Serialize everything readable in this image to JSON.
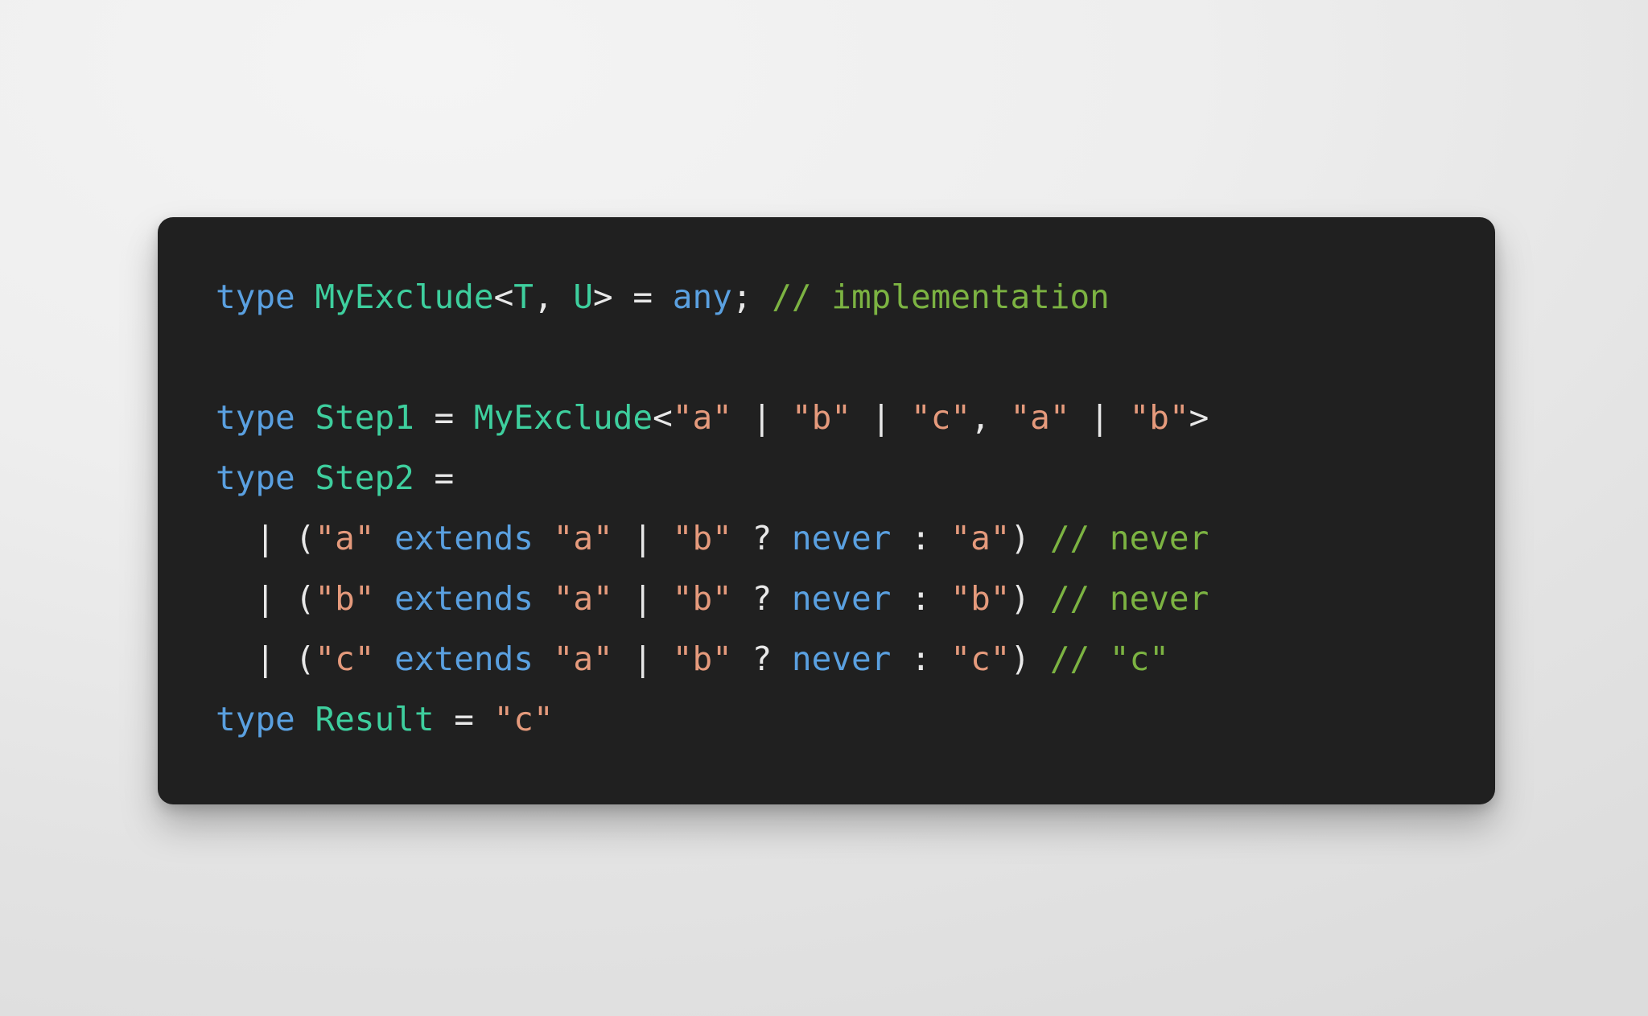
{
  "page": {
    "background_color": "#eeeeee",
    "card_background_color": "#202020"
  },
  "theme": {
    "keyword_color": "#5aa0e0",
    "type_color": "#3ecf9e",
    "string_color": "#e59a7c",
    "comment_color": "#7cb342",
    "punctuation_color": "#e8e8e8",
    "language": "typescript"
  },
  "code": {
    "full_text": "type MyExclude<T, U> = any; // implementation\n\ntype Step1 = MyExclude<\"a\" | \"b\" | \"c\", \"a\" | \"b\">\ntype Step2 =\n  | (\"a\" extends \"a\" | \"b\" ? never : \"a\") // never\n  | (\"b\" extends \"a\" | \"b\" ? never : \"b\") // never\n  | (\"c\" extends \"a\" | \"b\" ? never : \"c\") // \"c\"\ntype Result = \"c\"",
    "lines": [
      {
        "tokens": [
          {
            "text": "type",
            "kind": "keyword"
          },
          {
            "text": " ",
            "kind": "plain"
          },
          {
            "text": "MyExclude",
            "kind": "type"
          },
          {
            "text": "<",
            "kind": "punctuation"
          },
          {
            "text": "T",
            "kind": "type"
          },
          {
            "text": ", ",
            "kind": "punctuation"
          },
          {
            "text": "U",
            "kind": "type"
          },
          {
            "text": "> ",
            "kind": "punctuation"
          },
          {
            "text": "= ",
            "kind": "punctuation"
          },
          {
            "text": "any",
            "kind": "keyword"
          },
          {
            "text": "; ",
            "kind": "punctuation"
          },
          {
            "text": "// implementation",
            "kind": "comment"
          }
        ]
      },
      {
        "tokens": []
      },
      {
        "tokens": [
          {
            "text": "type",
            "kind": "keyword"
          },
          {
            "text": " ",
            "kind": "plain"
          },
          {
            "text": "Step1",
            "kind": "type"
          },
          {
            "text": " = ",
            "kind": "punctuation"
          },
          {
            "text": "MyExclude",
            "kind": "type"
          },
          {
            "text": "<",
            "kind": "punctuation"
          },
          {
            "text": "\"a\"",
            "kind": "string"
          },
          {
            "text": " | ",
            "kind": "punctuation"
          },
          {
            "text": "\"b\"",
            "kind": "string"
          },
          {
            "text": " | ",
            "kind": "punctuation"
          },
          {
            "text": "\"c\"",
            "kind": "string"
          },
          {
            "text": ", ",
            "kind": "punctuation"
          },
          {
            "text": "\"a\"",
            "kind": "string"
          },
          {
            "text": " | ",
            "kind": "punctuation"
          },
          {
            "text": "\"b\"",
            "kind": "string"
          },
          {
            "text": ">",
            "kind": "punctuation"
          }
        ]
      },
      {
        "tokens": [
          {
            "text": "type",
            "kind": "keyword"
          },
          {
            "text": " ",
            "kind": "plain"
          },
          {
            "text": "Step2",
            "kind": "type"
          },
          {
            "text": " =",
            "kind": "punctuation"
          }
        ]
      },
      {
        "tokens": [
          {
            "text": "  | (",
            "kind": "punctuation"
          },
          {
            "text": "\"a\"",
            "kind": "string"
          },
          {
            "text": " ",
            "kind": "plain"
          },
          {
            "text": "extends",
            "kind": "keyword"
          },
          {
            "text": " ",
            "kind": "plain"
          },
          {
            "text": "\"a\"",
            "kind": "string"
          },
          {
            "text": " | ",
            "kind": "punctuation"
          },
          {
            "text": "\"b\"",
            "kind": "string"
          },
          {
            "text": " ? ",
            "kind": "punctuation"
          },
          {
            "text": "never",
            "kind": "keyword"
          },
          {
            "text": " : ",
            "kind": "punctuation"
          },
          {
            "text": "\"a\"",
            "kind": "string"
          },
          {
            "text": ") ",
            "kind": "punctuation"
          },
          {
            "text": "// never",
            "kind": "comment"
          }
        ]
      },
      {
        "tokens": [
          {
            "text": "  | (",
            "kind": "punctuation"
          },
          {
            "text": "\"b\"",
            "kind": "string"
          },
          {
            "text": " ",
            "kind": "plain"
          },
          {
            "text": "extends",
            "kind": "keyword"
          },
          {
            "text": " ",
            "kind": "plain"
          },
          {
            "text": "\"a\"",
            "kind": "string"
          },
          {
            "text": " | ",
            "kind": "punctuation"
          },
          {
            "text": "\"b\"",
            "kind": "string"
          },
          {
            "text": " ? ",
            "kind": "punctuation"
          },
          {
            "text": "never",
            "kind": "keyword"
          },
          {
            "text": " : ",
            "kind": "punctuation"
          },
          {
            "text": "\"b\"",
            "kind": "string"
          },
          {
            "text": ") ",
            "kind": "punctuation"
          },
          {
            "text": "// never",
            "kind": "comment"
          }
        ]
      },
      {
        "tokens": [
          {
            "text": "  | (",
            "kind": "punctuation"
          },
          {
            "text": "\"c\"",
            "kind": "string"
          },
          {
            "text": " ",
            "kind": "plain"
          },
          {
            "text": "extends",
            "kind": "keyword"
          },
          {
            "text": " ",
            "kind": "plain"
          },
          {
            "text": "\"a\"",
            "kind": "string"
          },
          {
            "text": " | ",
            "kind": "punctuation"
          },
          {
            "text": "\"b\"",
            "kind": "string"
          },
          {
            "text": " ? ",
            "kind": "punctuation"
          },
          {
            "text": "never",
            "kind": "keyword"
          },
          {
            "text": " : ",
            "kind": "punctuation"
          },
          {
            "text": "\"c\"",
            "kind": "string"
          },
          {
            "text": ") ",
            "kind": "punctuation"
          },
          {
            "text": "// \"c\"",
            "kind": "comment"
          }
        ]
      },
      {
        "tokens": [
          {
            "text": "type",
            "kind": "keyword"
          },
          {
            "text": " ",
            "kind": "plain"
          },
          {
            "text": "Result",
            "kind": "type"
          },
          {
            "text": " = ",
            "kind": "punctuation"
          },
          {
            "text": "\"c\"",
            "kind": "string"
          }
        ]
      }
    ]
  }
}
